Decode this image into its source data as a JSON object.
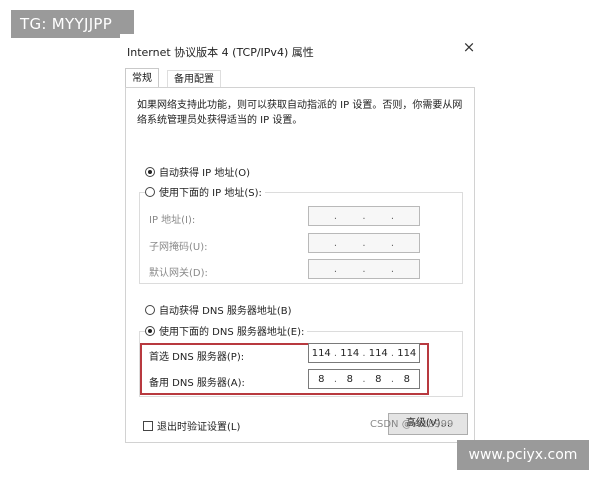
{
  "overlay": {
    "top_left": "TG: MYYJJPP",
    "bottom_right": "www.pciyx.com",
    "csdn": "CSDN @W18999"
  },
  "window": {
    "title": "Internet 协议版本 4 (TCP/IPv4) 属性",
    "close": "×"
  },
  "tabs": [
    {
      "label": "常规",
      "active": true
    },
    {
      "label": "备用配置",
      "active": false
    }
  ],
  "description": "如果网络支持此功能，则可以获取自动指派的 IP 设置。否则，你需要从网络系统管理员处获得适当的 IP 设置。",
  "ip": {
    "auto_label": "自动获得 IP 地址(O)",
    "manual_label": "使用下面的 IP 地址(S):",
    "selected": "auto",
    "fields": [
      {
        "label": "IP 地址(I):",
        "value": ""
      },
      {
        "label": "子网掩码(U):",
        "value": ""
      },
      {
        "label": "默认网关(D):",
        "value": ""
      }
    ]
  },
  "dns": {
    "auto_label": "自动获得 DNS 服务器地址(B)",
    "manual_label": "使用下面的 DNS 服务器地址(E):",
    "selected": "manual",
    "preferred": {
      "label": "首选 DNS 服务器(P):",
      "octets": [
        "114",
        "114",
        "114",
        "114"
      ]
    },
    "alternate": {
      "label": "备用 DNS 服务器(A):",
      "octets": [
        "8",
        "8",
        "8",
        "8"
      ]
    }
  },
  "validate_checkbox": {
    "label": "退出时验证设置(L)",
    "checked": false
  },
  "advanced_button": "高级(V)...",
  "colors": {
    "highlight_border": "#b8393f",
    "overlay_bg": "#9a9a9a"
  }
}
